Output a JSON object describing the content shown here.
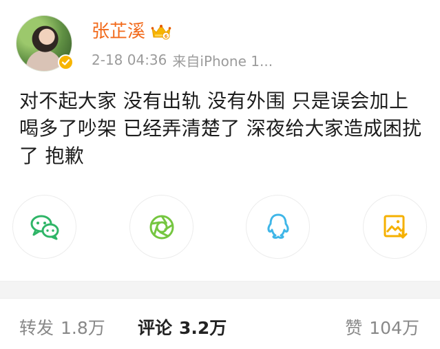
{
  "user": {
    "name": "张芷溪",
    "verified": true
  },
  "meta": {
    "timestamp": "2-18 04:36",
    "source": "来自iPhone 1..."
  },
  "post": {
    "text": "对不起大家 没有出轨 没有外围 只是误会加上喝多了吵架 已经弄清楚了 深夜给大家造成困扰了 抱歉"
  },
  "share": {
    "items": [
      {
        "icon": "wechat-icon"
      },
      {
        "icon": "moments-icon"
      },
      {
        "icon": "qq-icon"
      },
      {
        "icon": "save-image-icon"
      }
    ],
    "colors": {
      "wechat": "#2fb567",
      "moments": "#75c640",
      "qq": "#3fb6e8",
      "save": "#f5b000"
    }
  },
  "stats": {
    "repost_label": "转发",
    "repost_count": "1.8万",
    "comment_label": "评论",
    "comment_count": "3.2万",
    "like_label": "赞",
    "like_count": "104万"
  },
  "colors": {
    "username": "#f26a1b",
    "meta_text": "#9b9b9b",
    "body_text": "#1d1d1d",
    "divider": "#f4f4f4"
  }
}
